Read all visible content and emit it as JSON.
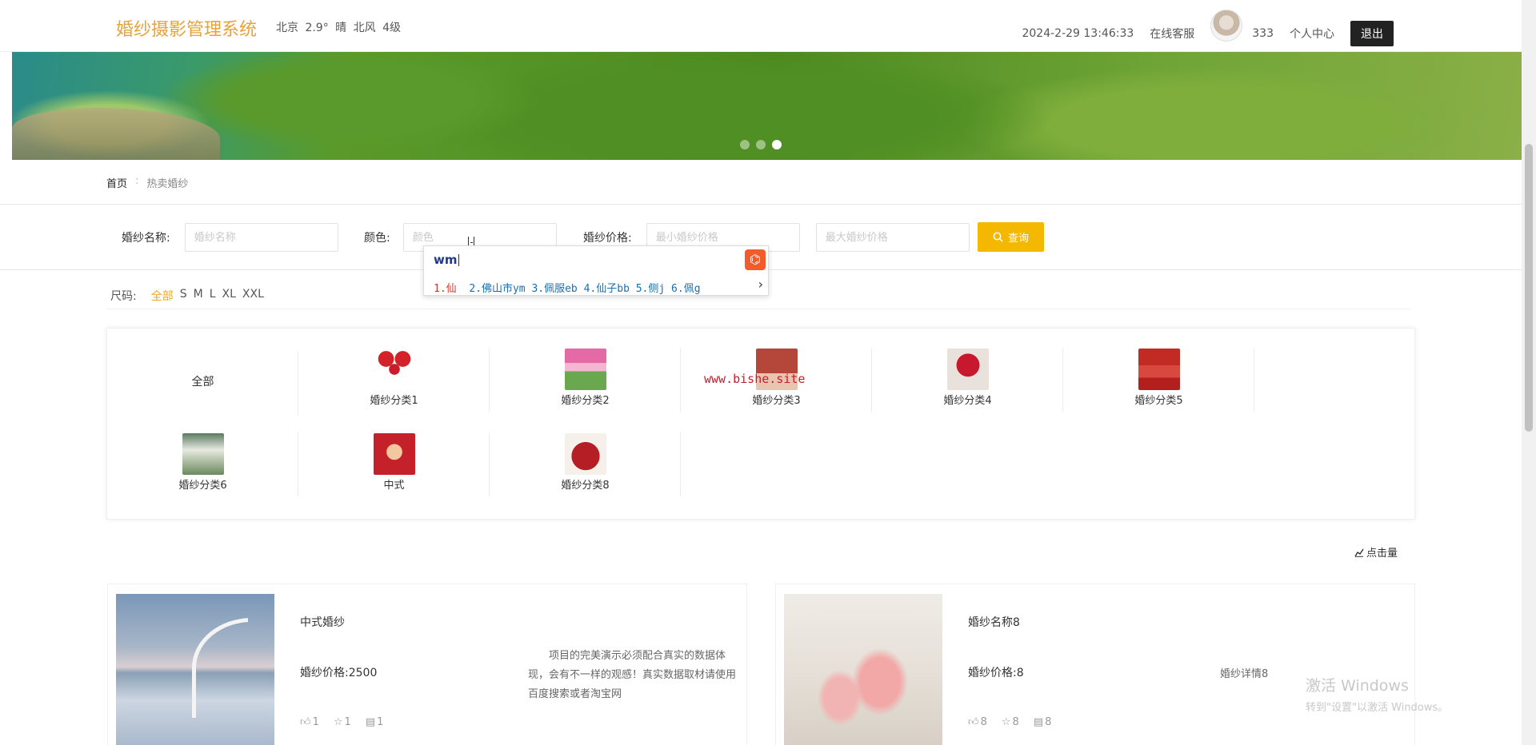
{
  "header": {
    "logo": "婚纱摄影管理系统",
    "weather": "北京  2.9°  晴  北风  4级",
    "datetime": "2024-2-29 13:46:33",
    "customer_service": "在线客服",
    "username": "333",
    "profile": "个人中心",
    "logout": "退出"
  },
  "banner": {
    "slide_count": 3,
    "active_slide": 3
  },
  "breadcrumb": {
    "home": "首页",
    "sep": ":",
    "current": "热卖婚纱"
  },
  "search": {
    "name_label": "婚纱名称:",
    "name_placeholder": "婚纱名称",
    "color_label": "颜色:",
    "color_placeholder": "颜色",
    "price_label": "婚纱价格:",
    "min_placeholder": "最小婚纱价格",
    "max_placeholder": "最大婚纱价格",
    "query_button": "查询"
  },
  "ime": {
    "composition": "wm",
    "candidates": [
      "1.仙",
      "2.佛山市ym",
      "3.佩服eb",
      "4.仙子bb",
      "5.侧j",
      "6.佩g"
    ]
  },
  "sizes": {
    "label": "尺码:",
    "options": [
      "全部",
      "S",
      "M",
      "L",
      "XL",
      "XXL"
    ],
    "selected": "全部"
  },
  "categories": [
    {
      "label": "全部"
    },
    {
      "label": "婚纱分类1"
    },
    {
      "label": "婚纱分类2"
    },
    {
      "label": "婚纱分类3"
    },
    {
      "label": "婚纱分类4"
    },
    {
      "label": "婚纱分类5"
    },
    {
      "label": "婚纱分类6"
    },
    {
      "label": "中式"
    },
    {
      "label": "婚纱分类8"
    }
  ],
  "watermark": "www.bishe.site",
  "sort": {
    "label": "点击量"
  },
  "products": [
    {
      "name": "中式婚纱",
      "price": "婚纱价格:2500",
      "desc": "项目的完美演示必须配合真实的数据体现，会有不一样的观感！真实数据取材请使用百度搜索或者淘宝网",
      "likes": "1",
      "favs": "1",
      "comments": "1"
    },
    {
      "name": "婚纱名称8",
      "price": "婚纱价格:8",
      "desc": "婚纱详情8",
      "likes": "8",
      "favs": "8",
      "comments": "8"
    }
  ],
  "windows": {
    "line1": "激活 Windows",
    "line2": "转到\"设置\"以激活 Windows。"
  },
  "colors": {
    "accent": "#f5b800",
    "logo": "#e8a23a",
    "size_active": "#f0a91d"
  }
}
